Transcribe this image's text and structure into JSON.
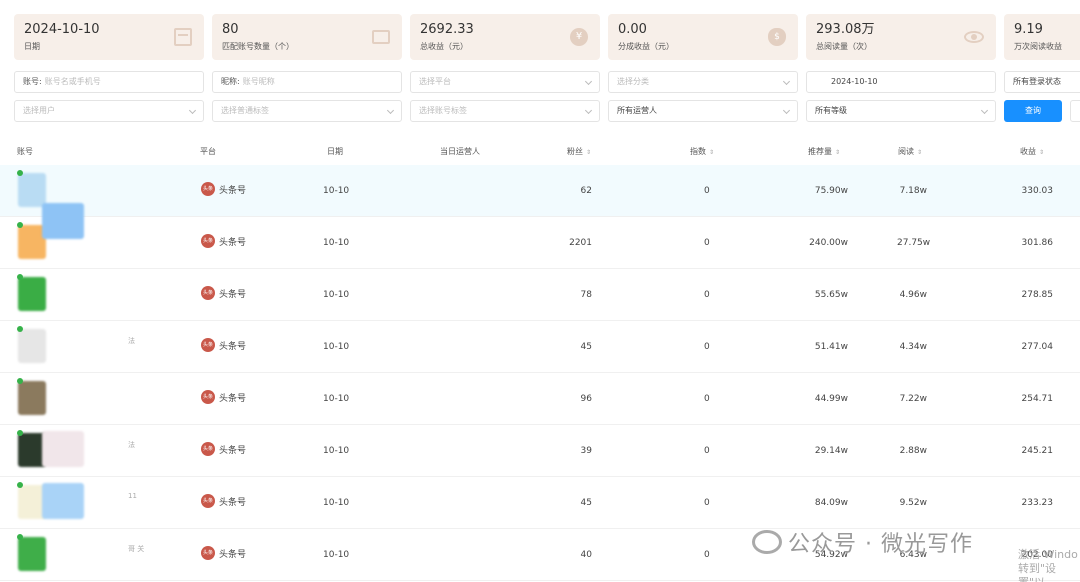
{
  "stats": [
    {
      "value": "2024-10-10",
      "label": "日期",
      "icon": "calendar-icon"
    },
    {
      "value": "80",
      "label": "匹配账号数量（个）",
      "icon": "id-card-icon"
    },
    {
      "value": "2692.33",
      "label": "总收益（元）",
      "icon": "yen-coin-icon"
    },
    {
      "value": "0.00",
      "label": "分成收益（元）",
      "icon": "money-bag-icon"
    },
    {
      "value": "293.08万",
      "label": "总阅读量（次）",
      "icon": "eye-icon"
    },
    {
      "value": "9.19",
      "label": "万次阅读收益"
    }
  ],
  "filters": {
    "account_prefix": "账号:",
    "account_placeholder": "账号名或手机号",
    "nickname_prefix": "昵称:",
    "nickname_placeholder": "账号昵称",
    "platform": "选择平台",
    "category": "选择分类",
    "date": "2024-10-10",
    "login_status": "所有登录状态",
    "user": "选择用户",
    "tag": "选择普通标签",
    "account_tag": "选择账号标签",
    "operator": "所有运营人",
    "level": "所有等级",
    "query_button": "查询"
  },
  "table": {
    "headers": {
      "account": "账号",
      "platform": "平台",
      "date": "日期",
      "operator": "当日运营人",
      "fans": "粉丝",
      "index": "指数",
      "recommend": "推荐量",
      "read": "阅读",
      "income": "收益"
    },
    "platform_badge": "头条",
    "rows": [
      {
        "platform": "头条号",
        "date": "10-10",
        "fans": "62",
        "index": "0",
        "recommend": "75.90w",
        "read": "7.18w",
        "income": "330.03",
        "side": ""
      },
      {
        "platform": "头条号",
        "date": "10-10",
        "fans": "2201",
        "index": "0",
        "recommend": "240.00w",
        "read": "27.75w",
        "income": "301.86",
        "side": ""
      },
      {
        "platform": "头条号",
        "date": "10-10",
        "fans": "78",
        "index": "0",
        "recommend": "55.65w",
        "read": "4.96w",
        "income": "278.85",
        "side": ""
      },
      {
        "platform": "头条号",
        "date": "10-10",
        "fans": "45",
        "index": "0",
        "recommend": "51.41w",
        "read": "4.34w",
        "income": "277.04",
        "side": "法"
      },
      {
        "platform": "头条号",
        "date": "10-10",
        "fans": "96",
        "index": "0",
        "recommend": "44.99w",
        "read": "7.22w",
        "income": "254.71",
        "side": ""
      },
      {
        "platform": "头条号",
        "date": "10-10",
        "fans": "39",
        "index": "0",
        "recommend": "29.14w",
        "read": "2.88w",
        "income": "245.21",
        "side": "法"
      },
      {
        "platform": "头条号",
        "date": "10-10",
        "fans": "45",
        "index": "0",
        "recommend": "84.09w",
        "read": "9.52w",
        "income": "233.23",
        "side": "11"
      },
      {
        "platform": "头条号",
        "date": "10-10",
        "fans": "40",
        "index": "0",
        "recommend": "54.92w",
        "read": "6.43w",
        "income": "202.00",
        "side": "哥 关"
      }
    ]
  },
  "watermark": "公众号 · 微光写作",
  "windows_activation": {
    "line1": "激活 Windo",
    "line2": "转到\"设置\"以"
  },
  "colors": {
    "accent": "#1890ff",
    "card_bg": "#f7efe9",
    "badge": "#c9584a",
    "online": "#36b24a"
  }
}
